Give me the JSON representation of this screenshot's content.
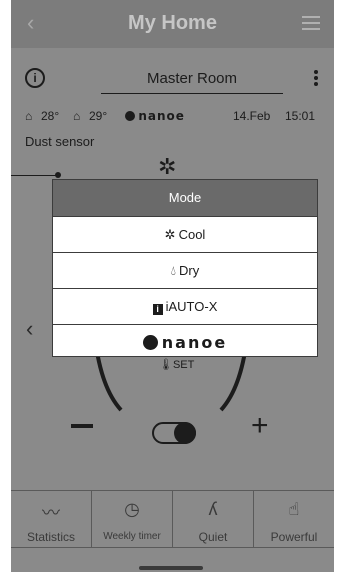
{
  "header": {
    "back_icon": "‹",
    "title": "My Home",
    "menu_icon": "hamburger-icon"
  },
  "room": {
    "info_icon": "i",
    "name": "Master Room",
    "more_icon": "kebab-icon"
  },
  "status": {
    "indoor_temp": "28°",
    "outdoor_temp": "29°",
    "nanoe_label": "nanoe",
    "date": "14.Feb",
    "time": "15:01"
  },
  "dust_sensor_label": "Dust sensor",
  "dial": {
    "set_label": "SET",
    "minus": "−",
    "plus": "+"
  },
  "modal": {
    "title": "Mode",
    "options": [
      {
        "icon": "snowflake-icon",
        "label": "Cool"
      },
      {
        "icon": "droplet-icon",
        "label": "Dry"
      },
      {
        "icon": "iauto-icon",
        "icon_text": "i",
        "label": "iAUTO-X"
      },
      {
        "icon": "nanoe-icon",
        "label": "nanoe"
      }
    ]
  },
  "bottom_nav": [
    {
      "icon": "statistics-icon",
      "label": "Statistics"
    },
    {
      "icon": "weekly-timer-icon",
      "label": "Weekly timer"
    },
    {
      "icon": "quiet-icon",
      "label": "Quiet"
    },
    {
      "icon": "powerful-icon",
      "label": "Powerful"
    }
  ]
}
